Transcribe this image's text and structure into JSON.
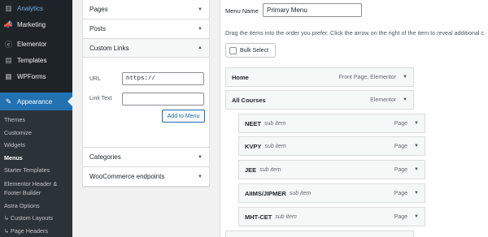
{
  "sidebar": {
    "top_items": [
      {
        "label": "Analytics",
        "icon": "analytics-icon",
        "glyph": "▥"
      },
      {
        "label": "Marketing",
        "icon": "megaphone-icon",
        "glyph": "📣"
      }
    ],
    "plugin_items": [
      {
        "label": "Elementor",
        "icon": "elementor-icon",
        "glyph": "ⓔ"
      },
      {
        "label": "Templates",
        "icon": "folder-icon",
        "glyph": "▤"
      },
      {
        "label": "WPForms",
        "icon": "form-icon",
        "glyph": "▦"
      }
    ],
    "active": {
      "label": "Appearance",
      "icon": "paintbrush-icon",
      "glyph": "✎"
    },
    "submenu": [
      "Themes",
      "Customize",
      "Widgets",
      "Menus",
      "Starter Templates",
      "Elementor Header & Footer Builder",
      "Astra Options",
      "↳ Custom Layouts",
      "↳ Page Headers"
    ]
  },
  "accordion": {
    "pages": "Pages",
    "posts": "Posts",
    "custom_links": "Custom Links",
    "url_label": "URL",
    "url_value": "https://",
    "link_text_label": "Link Text",
    "link_text_value": "",
    "add_button": "Add to Menu",
    "categories": "Categories",
    "woocommerce": "WooCommerce endpoints"
  },
  "menu": {
    "name_label": "Menu Name",
    "name_value": "Primary Menu",
    "instructions": "Drag the items into the order you prefer. Click the arrow on the right of the item to reveal additional c",
    "bulk_select": "Bulk Select",
    "items": [
      {
        "title": "Home",
        "sub": "",
        "type": "Front Page, Elementor"
      },
      {
        "title": "All Courses",
        "sub": "",
        "type": "Elementor"
      },
      {
        "title": "NEET",
        "sub": "sub item",
        "type": "Page"
      },
      {
        "title": "KVPY",
        "sub": "sub item",
        "type": "Page"
      },
      {
        "title": "JEE",
        "sub": "sub item",
        "type": "Page"
      },
      {
        "title": "AIIMS/JIPMER",
        "sub": "sub item",
        "type": "Page"
      },
      {
        "title": "MHT-CET",
        "sub": "sub item",
        "type": "Page"
      }
    ]
  },
  "colors": {
    "sidebar_bg": "#1d2327",
    "active_bg": "#2271b1",
    "accent": "#2271b1"
  }
}
